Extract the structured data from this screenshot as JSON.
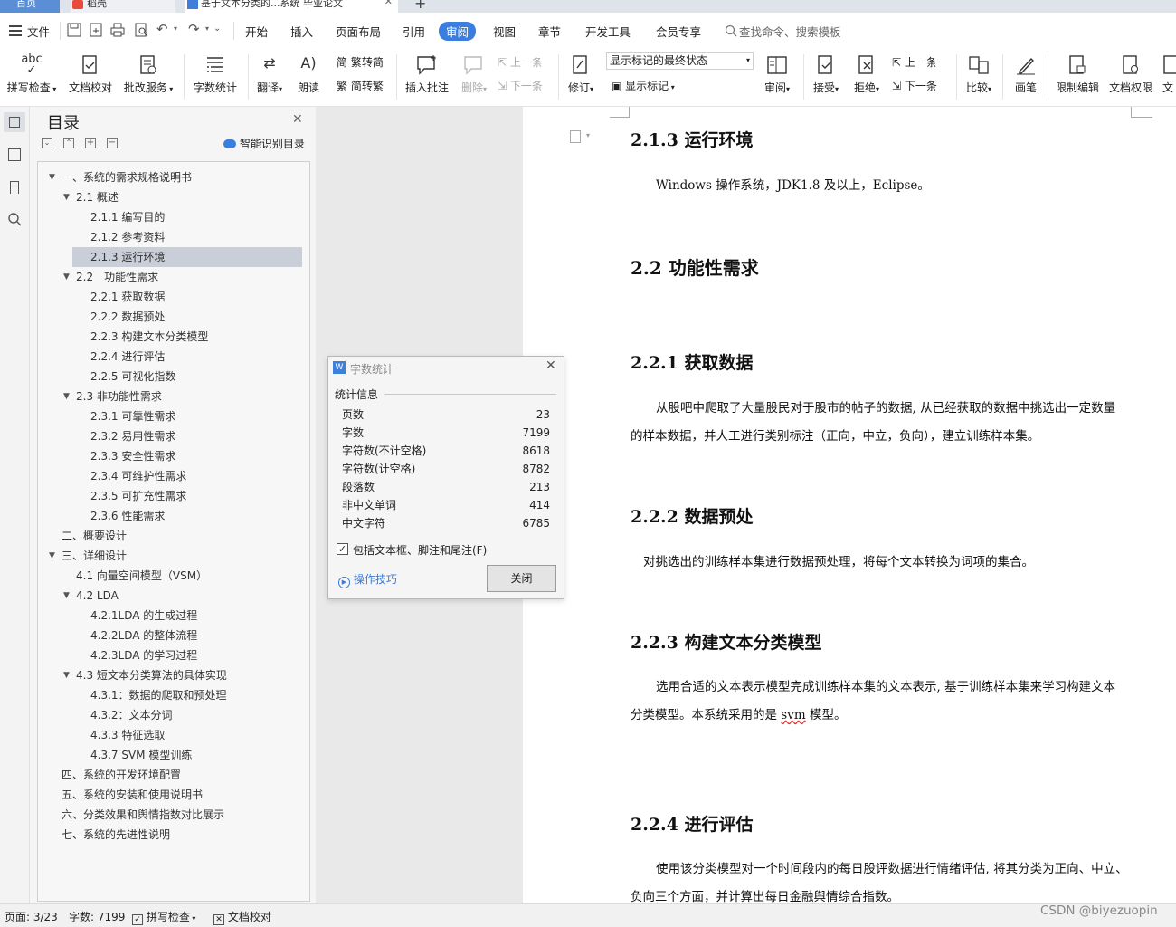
{
  "tabs": {
    "home": "首页",
    "wps": "稻壳",
    "doc": "基于文本分类的...系统 毕业论文",
    "add": "+"
  },
  "menu": {
    "file": "文件",
    "items": [
      "开始",
      "插入",
      "页面布局",
      "引用",
      "审阅",
      "视图",
      "章节",
      "开发工具",
      "会员专享"
    ],
    "active": "审阅",
    "search_placeholder": "查找命令、搜索模板"
  },
  "ribbon": {
    "spell": "拼写检查",
    "doc_proof": "文档校对",
    "correct": "批改服务",
    "word_count": "字数统计",
    "translate": "翻译",
    "read": "朗读",
    "trad": "繁转简",
    "simp": "简转繁",
    "insert_comment": "插入批注",
    "delete": "删除",
    "prev": "上一条",
    "next": "下一条",
    "revise": "修订",
    "markup_select": "显示标记的最终状态",
    "show_markup": "显示标记",
    "review": "审阅",
    "accept": "接受",
    "reject": "拒绝",
    "prev2": "上一条",
    "next2": "下一条",
    "compare": "比较",
    "pen": "画笔",
    "restrict": "限制编辑",
    "doc_perm": "文档权限",
    "doc_more": "文"
  },
  "toc": {
    "title": "目录",
    "smart": "智能识别目录",
    "items": [
      {
        "t": "一、系统的需求规格说明书"
      },
      {
        "t": "2.1 概述"
      },
      {
        "t": "2.1.1 编写目的"
      },
      {
        "t": "2.1.2 参考资料"
      },
      {
        "t": "2.1.3 运行环境"
      },
      {
        "t": "2.2　功能性需求"
      },
      {
        "t": "2.2.1 获取数据"
      },
      {
        "t": "2.2.2 数据预处"
      },
      {
        "t": "2.2.3 构建文本分类模型"
      },
      {
        "t": "2.2.4 进行评估"
      },
      {
        "t": "2.2.5 可视化指数"
      },
      {
        "t": "2.3  非功能性需求"
      },
      {
        "t": "2.3.1 可靠性需求"
      },
      {
        "t": "2.3.2 易用性需求"
      },
      {
        "t": "2.3.3 安全性需求"
      },
      {
        "t": "2.3.4 可维护性需求"
      },
      {
        "t": "2.3.5 可扩充性需求"
      },
      {
        "t": "2.3.6 性能需求"
      },
      {
        "t": "二、概要设计"
      },
      {
        "t": "三、详细设计"
      },
      {
        "t": "4.1 向量空间模型（VSM）"
      },
      {
        "t": "4.2 LDA"
      },
      {
        "t": "4.2.1LDA 的生成过程"
      },
      {
        "t": "4.2.2LDA 的整体流程"
      },
      {
        "t": "4.2.3LDA 的学习过程"
      },
      {
        "t": "4.3 短文本分类算法的具体实现"
      },
      {
        "t": "4.3.1：数据的爬取和预处理"
      },
      {
        "t": "4.3.2：文本分词"
      },
      {
        "t": "4.3.3  特征选取"
      },
      {
        "t": "4.3.7 SVM 模型训练"
      },
      {
        "t": "四、系统的开发环境配置"
      },
      {
        "t": "五、系统的安装和使用说明书"
      },
      {
        "t": "六、分类效果和舆情指数对比展示"
      },
      {
        "t": "七、系统的先进性说明"
      }
    ]
  },
  "doc": {
    "h_213": "2.1.3 运行环境",
    "p_213": "Windows 操作系统，JDK1.8 及以上，Eclipse。",
    "h_22": "2.2  功能性需求",
    "h_221": "2.2.1 获取数据",
    "p_221a": "从股吧中爬取了大量股民对于股市的帖子的数据, 从已经获取的数据中挑选出一定数量",
    "p_221b": "的样本数据，并人工进行类别标注（正向，中立，负向），建立训练样本集。",
    "h_222": "2.2.2 数据预处",
    "p_222": "对挑选出的训练样本集进行数据预处理，将每个文本转换为词项的集合。",
    "h_223": "2.2.3 构建文本分类模型",
    "p_223a": "选用合适的文本表示模型完成训练样本集的文本表示, 基于训练样本集来学习构建文本",
    "p_223b_pre": "分类模型。本系统采用的是 ",
    "p_223b_svm": "svm",
    "p_223b_post": " 模型。",
    "h_224": "2.2.4 进行评估",
    "p_224a": "使用该分类模型对一个时间段内的每日股评数据进行情绪评估, 将其分类为正向、中立、",
    "p_224b": "负向三个方面，并计算出每日金融舆情综合指数。"
  },
  "dialog": {
    "title": "字数统计",
    "section": "统计信息",
    "rows": [
      {
        "k": "页数",
        "v": "23"
      },
      {
        "k": "字数",
        "v": "7199"
      },
      {
        "k": "字符数(不计空格)",
        "v": "8618"
      },
      {
        "k": "字符数(计空格)",
        "v": "8782"
      },
      {
        "k": "段落数",
        "v": "213"
      },
      {
        "k": "非中文单词",
        "v": "414"
      },
      {
        "k": "中文字符",
        "v": "6785"
      }
    ],
    "checkbox": "包括文本框、脚注和尾注(F)",
    "checked": true,
    "tips": "操作技巧",
    "close": "关闭"
  },
  "status": {
    "page": "页面: 3/23",
    "words": "字数: 7199",
    "spell": "拼写检查",
    "proof": "文档校对",
    "watermark": "CSDN @biyezuopin"
  }
}
